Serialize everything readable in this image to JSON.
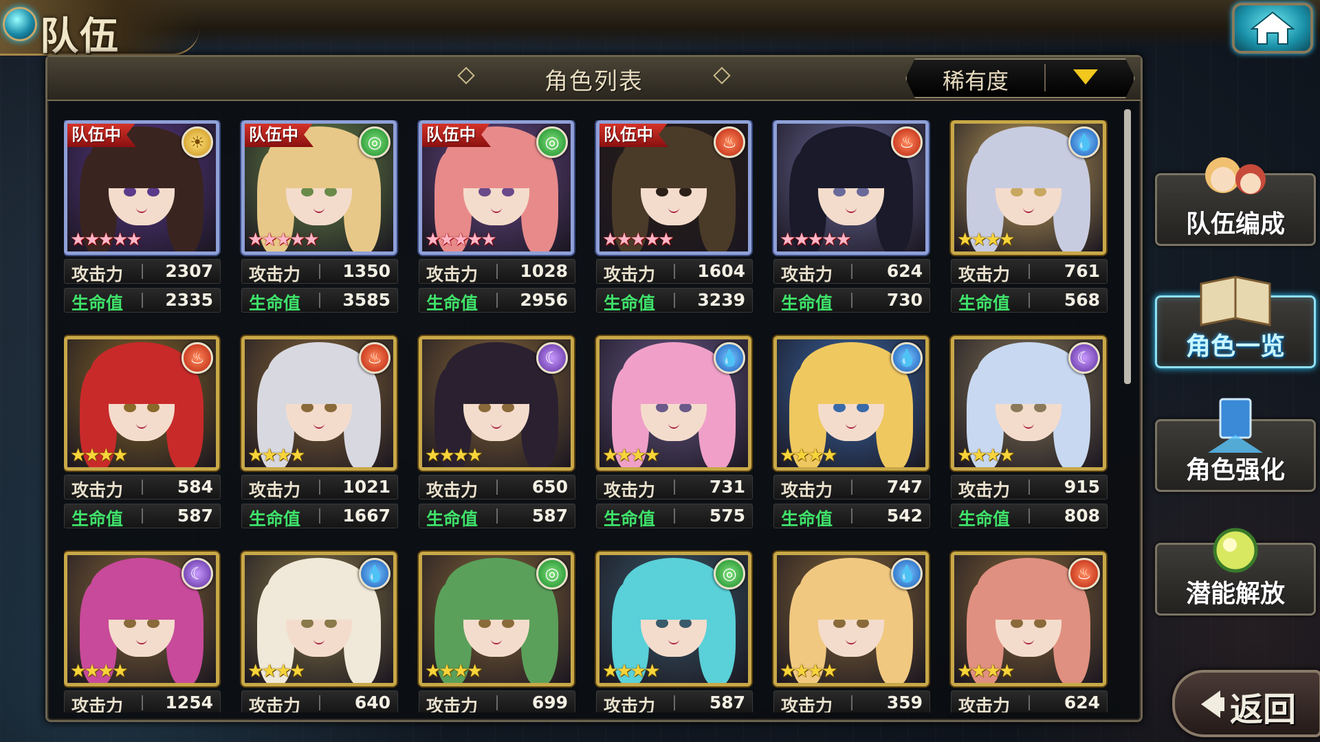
{
  "header": {
    "title": "队伍",
    "home_icon": "home-icon"
  },
  "list": {
    "title": "角色列表",
    "sort_label": "稀有度",
    "stat_labels": {
      "atk": "攻击力",
      "hp": "生命值"
    },
    "team_badge": "队伍中"
  },
  "characters": [
    {
      "in_team": true,
      "element": "sun",
      "stars": 5,
      "atk": "2307",
      "hp": "2335"
    },
    {
      "in_team": true,
      "element": "wind",
      "stars": 5,
      "atk": "1350",
      "hp": "3585"
    },
    {
      "in_team": true,
      "element": "wind",
      "stars": 5,
      "atk": "1028",
      "hp": "2956"
    },
    {
      "in_team": true,
      "element": "fire",
      "stars": 5,
      "atk": "1604",
      "hp": "3239"
    },
    {
      "in_team": false,
      "element": "fire",
      "stars": 5,
      "atk": "624",
      "hp": "730"
    },
    {
      "in_team": false,
      "element": "water",
      "stars": 4,
      "atk": "761",
      "hp": "568"
    },
    {
      "in_team": false,
      "element": "fire",
      "stars": 4,
      "atk": "584",
      "hp": "587"
    },
    {
      "in_team": false,
      "element": "fire",
      "stars": 4,
      "atk": "1021",
      "hp": "1667"
    },
    {
      "in_team": false,
      "element": "dark",
      "stars": 4,
      "atk": "650",
      "hp": "587"
    },
    {
      "in_team": false,
      "element": "water",
      "stars": 4,
      "atk": "731",
      "hp": "575"
    },
    {
      "in_team": false,
      "element": "water",
      "stars": 4,
      "atk": "747",
      "hp": "542"
    },
    {
      "in_team": false,
      "element": "dark",
      "stars": 4,
      "atk": "915",
      "hp": "808"
    },
    {
      "in_team": false,
      "element": "dark",
      "stars": 4,
      "atk": "1254",
      "hp": ""
    },
    {
      "in_team": false,
      "element": "water",
      "stars": 4,
      "atk": "640",
      "hp": ""
    },
    {
      "in_team": false,
      "element": "wind",
      "stars": 4,
      "atk": "699",
      "hp": ""
    },
    {
      "in_team": false,
      "element": "wind",
      "stars": 4,
      "atk": "587",
      "hp": ""
    },
    {
      "in_team": false,
      "element": "water",
      "stars": 4,
      "atk": "359",
      "hp": ""
    },
    {
      "in_team": false,
      "element": "fire",
      "stars": 4,
      "atk": "624",
      "hp": ""
    }
  ],
  "side_menu": [
    {
      "label": "队伍编成",
      "icon": "team-portraits-icon",
      "active": false
    },
    {
      "label": "角色一览",
      "icon": "book-icon",
      "active": true
    },
    {
      "label": "角色强化",
      "icon": "upgrade-card-icon",
      "active": false
    },
    {
      "label": "潜能解放",
      "icon": "potential-orb-icon",
      "active": false
    }
  ],
  "back_button": {
    "label": "返回",
    "icon": "back-arrow-icon"
  },
  "colors": {
    "atk_label": "#e8e0cc",
    "hp_label": "#3fe26a",
    "team_badge": "#d8352a",
    "sort_arrow": "#f2c81e",
    "active_menu_glow": "#8fe0f4"
  }
}
